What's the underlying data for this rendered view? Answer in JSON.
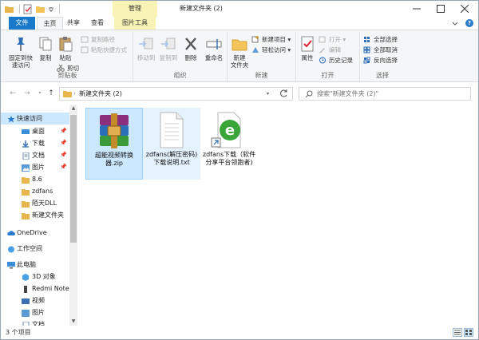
{
  "window": {
    "title": "新建文件夹 (2)",
    "manage_tab": "管理"
  },
  "tabs": {
    "file": "文件",
    "home": "主页",
    "share": "共享",
    "view": "查看",
    "tools": "图片工具"
  },
  "ribbon": {
    "clipboard": {
      "label": "剪贴板",
      "pin": "固定到快\n速访问",
      "copy": "复制",
      "paste": "粘贴",
      "copy_path": "复制路径",
      "paste_shortcut": "粘贴快捷方式",
      "cut": "剪切"
    },
    "organize": {
      "label": "组织",
      "move_to": "移动到",
      "copy_to": "复制到",
      "delete": "删除",
      "rename": "重命名"
    },
    "new": {
      "label": "新建",
      "new_folder": "新建\n文件夹",
      "new_item": "新建项目",
      "easy_access": "轻松访问"
    },
    "open": {
      "label": "打开",
      "properties": "属性",
      "open": "打开",
      "edit": "编辑",
      "history": "历史记录"
    },
    "select": {
      "label": "选择",
      "select_all": "全部选择",
      "select_none": "全部取消",
      "invert": "反向选择"
    }
  },
  "address": {
    "path": "新建文件夹 (2)",
    "search_placeholder": "搜索\"新建文件夹 (2)\""
  },
  "nav": {
    "quick_access": "快速访问",
    "items": [
      {
        "label": "桌面",
        "pinned": true
      },
      {
        "label": "下载",
        "pinned": true
      },
      {
        "label": "文档",
        "pinned": true
      },
      {
        "label": "图片",
        "pinned": true
      },
      {
        "label": "8.6",
        "pinned": false
      },
      {
        "label": "zdfans",
        "pinned": false
      },
      {
        "label": "陌天DLL",
        "pinned": false
      },
      {
        "label": "新建文件夹",
        "pinned": false
      }
    ],
    "onedrive": "OneDrive",
    "workspace": "工作空间",
    "this_pc": "此电脑",
    "pc_items": [
      "3D 对象",
      "Redmi Note",
      "视频",
      "图片",
      "文档"
    ],
    "pin_glyph": "📌"
  },
  "files": [
    {
      "name": "超能视频转换器.zip",
      "icon": "winrar-archive-icon",
      "state": "selected"
    },
    {
      "name": "zdfans(解压密码)下载说明.txt",
      "icon": "text-file-icon",
      "state": "hover"
    },
    {
      "name": "zdfans下载（软件分享平台领跑者)",
      "icon": "browser-shortcut-icon",
      "state": "normal"
    }
  ],
  "status": {
    "count": "3 个项目"
  },
  "colors": {
    "accent": "#1979ca",
    "selected_bg": "#cce8ff",
    "tools_tab": "#f9f4b5"
  }
}
